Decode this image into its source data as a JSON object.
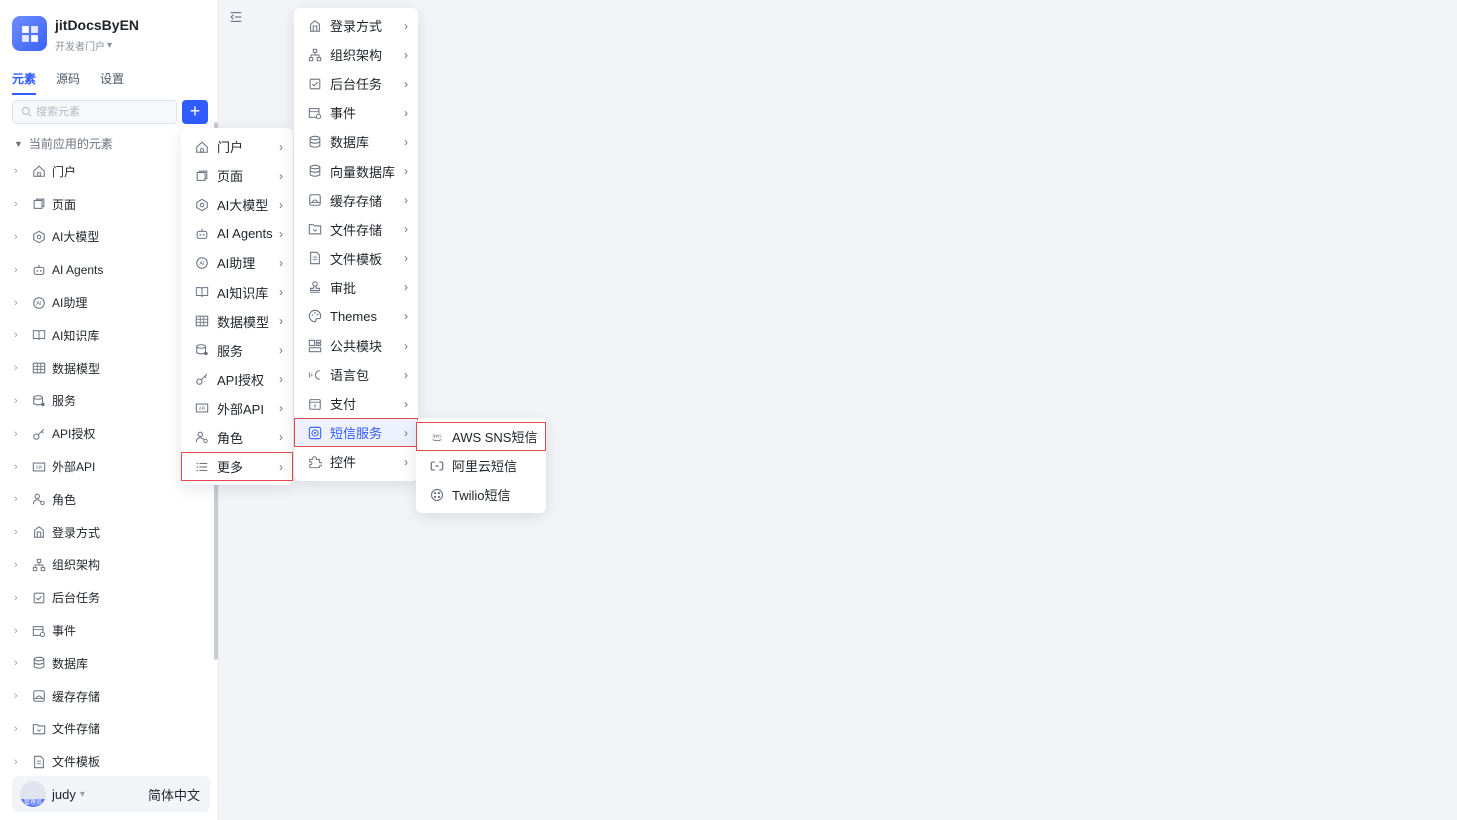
{
  "app": {
    "name": "jitDocsByEN",
    "subtitle": "开发者门户"
  },
  "tabs": [
    "元素",
    "源码",
    "设置"
  ],
  "search": {
    "placeholder": "搜索元素"
  },
  "add_button": "+",
  "tree": {
    "root": "当前应用的元素",
    "items": [
      "门户",
      "页面",
      "AI大模型",
      "AI Agents",
      "AI助理",
      "AI知识库",
      "数据模型",
      "服务",
      "API授权",
      "外部API",
      "角色",
      "登录方式",
      "组织架构",
      "后台任务",
      "事件",
      "数据库",
      "缓存存储",
      "文件存储",
      "文件模板"
    ]
  },
  "user": {
    "name": "judy",
    "role_tag": "管理员",
    "language": "简体中文"
  },
  "menu1": {
    "items": [
      "门户",
      "页面",
      "AI大模型",
      "AI Agents",
      "AI助理",
      "AI知识库",
      "数据模型",
      "服务",
      "API授权",
      "外部API",
      "角色",
      "更多"
    ]
  },
  "menu2": {
    "items": [
      "登录方式",
      "组织架构",
      "后台任务",
      "事件",
      "数据库",
      "向量数据库",
      "缓存存储",
      "文件存储",
      "文件模板",
      "审批",
      "Themes",
      "公共模块",
      "语言包",
      "支付",
      "短信服务",
      "控件"
    ]
  },
  "menu3": {
    "items": [
      "AWS SNS短信",
      "阿里云短信",
      "Twilio短信"
    ]
  },
  "colors": {
    "accent": "#2f5bff",
    "highlight_border": "#e5484d"
  }
}
